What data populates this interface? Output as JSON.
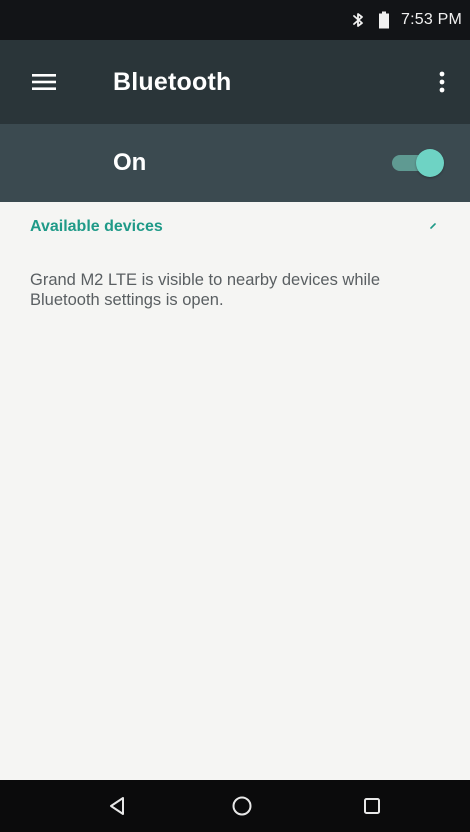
{
  "status_bar": {
    "time": "7:53 PM",
    "icons": [
      "bluetooth-icon",
      "battery-icon"
    ]
  },
  "app_bar": {
    "title": "Bluetooth",
    "menu_icon": "hamburger-menu-icon",
    "overflow_icon": "more-vert-icon"
  },
  "bluetooth_toggle": {
    "label": "On",
    "state": true,
    "accent": "#6ed3c4"
  },
  "content": {
    "section_header": "Available devices",
    "visibility_message": "Grand M2 LTE is visible to nearby devices while Bluetooth settings is open."
  },
  "nav_bar": {
    "buttons": [
      "back-icon",
      "home-icon",
      "recent-apps-icon"
    ]
  },
  "colors": {
    "status_bar": "#121417",
    "app_bar": "#2a3539",
    "toggle_bar": "#3b4a50",
    "accent": "#1f9a88",
    "background": "#f5f5f3",
    "nav_bar": "#0b0b0c"
  }
}
